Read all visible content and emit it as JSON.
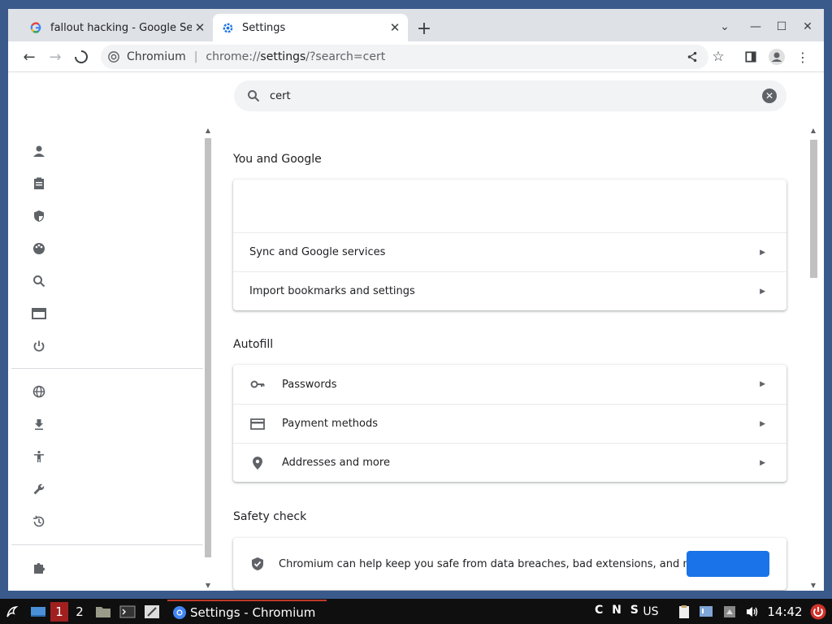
{
  "browser": {
    "tabs": [
      {
        "title": "fallout hacking - Google Se",
        "favicon": "google-g-icon"
      },
      {
        "title": "Settings",
        "favicon": "settings-gear-icon"
      }
    ],
    "omnibox": {
      "site_name": "Chromium",
      "url_prefix": "chrome://",
      "url_host": "settings",
      "url_suffix": "/?search=cert"
    }
  },
  "settings": {
    "search": {
      "value": "cert"
    },
    "sections": {
      "you_and_google": {
        "title": "You and Google",
        "rows": [
          "Sync and Google services",
          "Import bookmarks and settings"
        ]
      },
      "autofill": {
        "title": "Autofill",
        "rows": [
          "Passwords",
          "Payment methods",
          "Addresses and more"
        ]
      },
      "safety_check": {
        "title": "Safety check",
        "description": "Chromium can help keep you safe from data breaches, bad extensions, and more"
      }
    },
    "nav_icons": [
      "person-icon",
      "clipboard-icon",
      "shield-icon",
      "palette-icon",
      "search-icon",
      "browser-icon",
      "power-icon",
      "globe-icon",
      "download-icon",
      "accessibility-icon",
      "wrench-icon",
      "history-icon",
      "extension-icon"
    ]
  },
  "taskbar": {
    "workspace_1": "1",
    "workspace_2": "2",
    "active_window": "Settings - Chromium",
    "indicators": "C N S",
    "layout": "US",
    "clock": "14:42"
  }
}
